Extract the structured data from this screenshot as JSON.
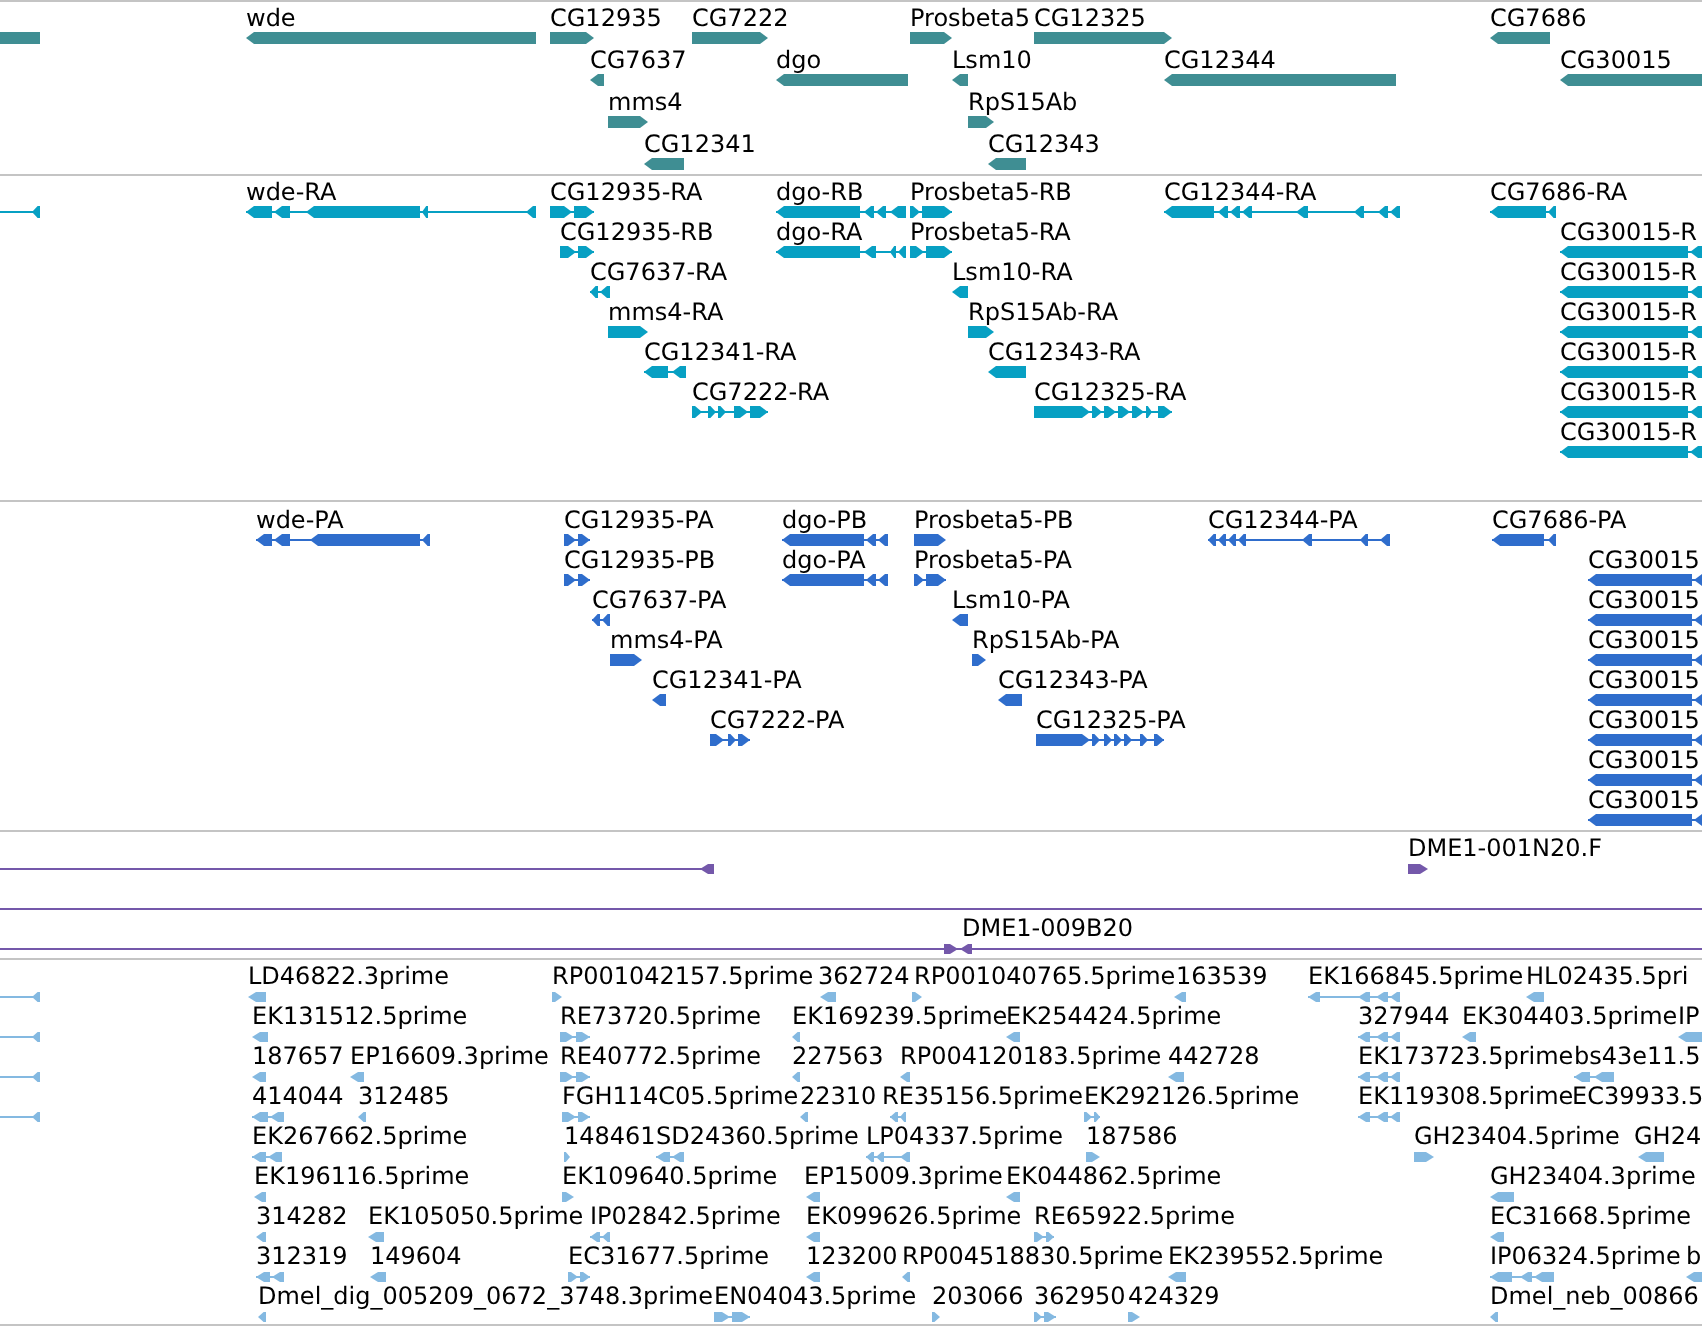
{
  "tracks": [
    {
      "kind": "gene",
      "features": [
        {
          "reverse": true
        },
        {
          "label": "wde",
          "reverse": true
        },
        {
          "label": "CG12935",
          "reverse": false
        },
        {
          "label": "CG7222",
          "reverse": false
        },
        {
          "label": "Prosbeta5",
          "reverse": false
        },
        {
          "label": "CG12325",
          "reverse": false
        },
        {
          "label": "CG7686",
          "reverse": true
        },
        {
          "label": "CG7637",
          "reverse": true
        },
        {
          "label": "dgo",
          "reverse": true
        },
        {
          "label": "Lsm10",
          "reverse": true
        },
        {
          "label": "CG12344",
          "reverse": true
        },
        {
          "label": "CG30015",
          "reverse": true
        },
        {
          "label": "mms4",
          "reverse": false
        },
        {
          "label": "RpS15Ab",
          "reverse": false
        },
        {
          "label": "CG12341",
          "reverse": true
        },
        {
          "label": "CG12343",
          "reverse": true
        }
      ]
    },
    {
      "kind": "transcript",
      "features": [
        {
          "reverse": true
        },
        {
          "label": "wde-RA",
          "reverse": true
        },
        {
          "label": "CG12935-RA",
          "reverse": false
        },
        {
          "label": "dgo-RB",
          "reverse": true
        },
        {
          "label": "Prosbeta5-RB",
          "reverse": false
        },
        {
          "label": "CG12344-RA",
          "reverse": true
        },
        {
          "label": "CG7686-RA",
          "reverse": true
        },
        {
          "label": "CG12935-RB",
          "reverse": false
        },
        {
          "label": "dgo-RA",
          "reverse": true
        },
        {
          "label": "Prosbeta5-RA",
          "reverse": false
        },
        {
          "label": "CG30015-R",
          "reverse": true
        },
        {
          "label": "CG7637-RA",
          "reverse": true
        },
        {
          "label": "Lsm10-RA",
          "reverse": true
        },
        {
          "label": "CG30015-R",
          "reverse": true
        },
        {
          "label": "mms4-RA",
          "reverse": false
        },
        {
          "label": "RpS15Ab-RA",
          "reverse": false
        },
        {
          "label": "CG30015-R",
          "reverse": true
        },
        {
          "label": "CG12341-RA",
          "reverse": true
        },
        {
          "label": "CG12343-RA",
          "reverse": true
        },
        {
          "label": "CG30015-R",
          "reverse": true
        },
        {
          "label": "CG7222-RA",
          "reverse": false
        },
        {
          "label": "CG12325-RA",
          "reverse": false
        },
        {
          "label": "CG30015-R",
          "reverse": true
        },
        {
          "label": "CG30015-R",
          "reverse": true
        }
      ]
    },
    {
      "kind": "protein",
      "features": [
        {
          "label": "wde-PA",
          "reverse": true
        },
        {
          "label": "CG12935-PA",
          "reverse": false
        },
        {
          "label": "dgo-PB",
          "reverse": true
        },
        {
          "label": "Prosbeta5-PB",
          "reverse": false
        },
        {
          "label": "CG12344-PA",
          "reverse": true
        },
        {
          "label": "CG7686-PA",
          "reverse": true
        },
        {
          "label": "CG12935-PB",
          "reverse": false
        },
        {
          "label": "dgo-PA",
          "reverse": true
        },
        {
          "label": "Prosbeta5-PA",
          "reverse": false
        },
        {
          "label": "CG30015",
          "reverse": true
        },
        {
          "label": "CG7637-PA",
          "reverse": true
        },
        {
          "label": "Lsm10-PA",
          "reverse": true
        },
        {
          "label": "CG30015",
          "reverse": true
        },
        {
          "label": "mms4-PA",
          "reverse": false
        },
        {
          "label": "RpS15Ab-PA",
          "reverse": false
        },
        {
          "label": "CG30015",
          "reverse": true
        },
        {
          "label": "CG12341-PA",
          "reverse": true
        },
        {
          "label": "CG12343-PA",
          "reverse": true
        },
        {
          "label": "CG30015",
          "reverse": true
        },
        {
          "label": "CG7222-PA",
          "reverse": false
        },
        {
          "label": "CG12325-PA",
          "reverse": false
        },
        {
          "label": "CG30015",
          "reverse": true
        },
        {
          "label": "CG30015",
          "reverse": true
        },
        {
          "label": "CG30015",
          "reverse": true
        }
      ]
    },
    {
      "kind": "clone",
      "features": [
        {
          "kind": "line",
          "reverse": true
        },
        {
          "kind": "arrow",
          "label": "DME1-001N20.F",
          "reverse": false
        },
        {
          "kind": "line"
        },
        {
          "kind": "line",
          "label": "DME1-009B20",
          "reverse": false,
          "paired_ends": true
        }
      ]
    },
    {
      "kind": "est",
      "features": [
        {
          "reverse": true
        },
        {
          "label": "LD46822.3prime",
          "reverse": true
        },
        {
          "label": "RP001042157.5prime",
          "reverse": false
        },
        {
          "label": "362724",
          "reverse": true
        },
        {
          "label": "RP001040765.5prime",
          "reverse": false
        },
        {
          "label": "163539",
          "reverse": true
        },
        {
          "label": "EK166845.5prime",
          "reverse": true
        },
        {
          "label": "HL02435.5pri",
          "reverse": true
        },
        {
          "reverse": true
        },
        {
          "label": "EK131512.5prime",
          "reverse": true
        },
        {
          "label": "RE73720.5prime",
          "reverse": false
        },
        {
          "label": "EK169239.5prime",
          "reverse": true
        },
        {
          "label": "EK254424.5prime",
          "reverse": true
        },
        {
          "label": "327944",
          "reverse": true
        },
        {
          "label": "EK304403.5prime",
          "reverse": true
        },
        {
          "label": "IP",
          "reverse": true
        },
        {
          "reverse": true
        },
        {
          "label": "187657",
          "reverse": true
        },
        {
          "label": "EP16609.3prime",
          "reverse": true
        },
        {
          "label": "RE40772.5prime",
          "reverse": false
        },
        {
          "label": "227563",
          "reverse": true
        },
        {
          "label": "RP004120183.5prime",
          "reverse": true
        },
        {
          "label": "442728",
          "reverse": true
        },
        {
          "label": "EK173723.5prime",
          "reverse": true
        },
        {
          "label": "bs43e11.5",
          "reverse": true
        },
        {
          "reverse": true
        },
        {
          "label": "414044",
          "reverse": true
        },
        {
          "label": "312485",
          "reverse": true
        },
        {
          "label": "FGH114C05.5prime",
          "reverse": false
        },
        {
          "label": "22310",
          "reverse": true
        },
        {
          "label": "RE35156.5prime",
          "reverse": true
        },
        {
          "label": "EK292126.5prime",
          "reverse": false
        },
        {
          "label": "EK119308.5prime",
          "reverse": true
        },
        {
          "label": "EC39933.5"
        },
        {
          "label": "EK267662.5prime",
          "reverse": true
        },
        {
          "label": "148461",
          "reverse": false
        },
        {
          "label": "SD24360.5prime",
          "reverse": true
        },
        {
          "label": "LP04337.5prime",
          "reverse": true
        },
        {
          "label": "187586",
          "reverse": false
        },
        {
          "label": "GH23404.5prime",
          "reverse": false
        },
        {
          "label": "GH24",
          "reverse": true
        },
        {
          "label": "EK196116.5prime",
          "reverse": true
        },
        {
          "label": "EK109640.5prime",
          "reverse": false
        },
        {
          "label": "EP15009.3prime",
          "reverse": true
        },
        {
          "label": "EK044862.5prime",
          "reverse": true
        },
        {
          "label": "GH23404.3prime",
          "reverse": true
        },
        {
          "label": "314282",
          "reverse": true
        },
        {
          "label": "EK105050.5prime",
          "reverse": true
        },
        {
          "label": "IP02842.5prime",
          "reverse": true
        },
        {
          "label": "EK099626.5prime",
          "reverse": true
        },
        {
          "label": "RE65922.5prime",
          "reverse": false
        },
        {
          "label": "EC31668.5prime",
          "reverse": true
        },
        {
          "label": "312319",
          "reverse": true
        },
        {
          "label": "149604",
          "reverse": true
        },
        {
          "label": "EC31677.5prime",
          "reverse": false
        },
        {
          "label": "123200",
          "reverse": true
        },
        {
          "label": "RP004518830.5prime",
          "reverse": true
        },
        {
          "label": "EK239552.5prime",
          "reverse": true
        },
        {
          "label": "IP06324.5prime",
          "reverse": true
        },
        {
          "label": "b",
          "reverse": true
        },
        {
          "label": "Dmel_dig_005209_0672_3748.3prime",
          "reverse": true
        },
        {
          "label": "EN04043.5prime",
          "reverse": false
        },
        {
          "label": "203066",
          "reverse": false
        },
        {
          "label": "362950",
          "reverse": false
        },
        {
          "label": "424329",
          "reverse": false
        },
        {
          "label": "Dmel_neb_00866",
          "reverse": true
        }
      ]
    }
  ]
}
